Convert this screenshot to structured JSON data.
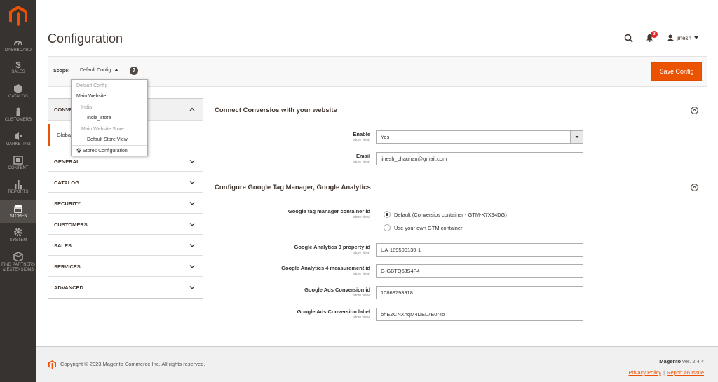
{
  "sidebar": {
    "items": [
      {
        "label": "DASHBOARD",
        "icon": "dashboard-icon"
      },
      {
        "label": "SALES",
        "icon": "dollar-icon"
      },
      {
        "label": "CATALOG",
        "icon": "cube-icon"
      },
      {
        "label": "CUSTOMERS",
        "icon": "person-icon"
      },
      {
        "label": "MARKETING",
        "icon": "megaphone-icon"
      },
      {
        "label": "CONTENT",
        "icon": "content-icon"
      },
      {
        "label": "REPORTS",
        "icon": "bar-chart-icon"
      },
      {
        "label": "STORES",
        "icon": "store-icon"
      },
      {
        "label": "SYSTEM",
        "icon": "gear-icon"
      },
      {
        "label": "FIND PARTNERS & EXTENSIONS",
        "icon": "box-icon"
      }
    ]
  },
  "header": {
    "title": "Configuration",
    "notification_count": "3",
    "user": "jinesh"
  },
  "scope": {
    "label": "Scope:",
    "current": "Default Config",
    "save_label": "Save Config",
    "dropdown": [
      "Default Config",
      "Main Website",
      "India",
      "India_store",
      "Main Website Store",
      "Default Store View",
      "Stores Configuration"
    ]
  },
  "tabs": {
    "conversios": "CONVERSIOS",
    "global": "Global",
    "items": [
      "GENERAL",
      "CATALOG",
      "SECURITY",
      "CUSTOMERS",
      "SALES",
      "SERVICES",
      "ADVANCED"
    ]
  },
  "section1": {
    "title": "Connect Conversios with your website",
    "enable_label": "Enable",
    "enable_value": "Yes",
    "email_label": "Email",
    "email_value": "jinesh_chauhan@gmail.com"
  },
  "section2": {
    "title": "Configure Google Tag Manager, Google Analytics",
    "gtm_label": "Google tag manager container id",
    "gtm_option_default": "Default (Conversios container - GTM-K7X94DG)",
    "gtm_option_own": "Use your own GTM container",
    "ga3_label": "Google Analytics 3 property id",
    "ga3_value": "UA-189500139-1",
    "ga4_label": "Google Analytics 4 measurement id",
    "ga4_value": "G-GBTQ6JS4F4",
    "ads_id_label": "Google Ads Conversion id",
    "ads_id_value": "10868793918",
    "ads_label_label": "Google Ads Conversion label",
    "ads_label_value": "ohEZCNXnqM4DEL7E0r4o"
  },
  "scope_note": "[store view]",
  "footer": {
    "copyright": "Copyright © 2023 Magento Commerce Inc. All rights reserved.",
    "brand": "Magento",
    "version": "ver. 2.4.4",
    "privacy": "Privacy Policy",
    "report": "Report an Issue"
  },
  "colors": {
    "accent": "#eb5202",
    "sidebar": "#373330",
    "badge": "#e22626"
  }
}
